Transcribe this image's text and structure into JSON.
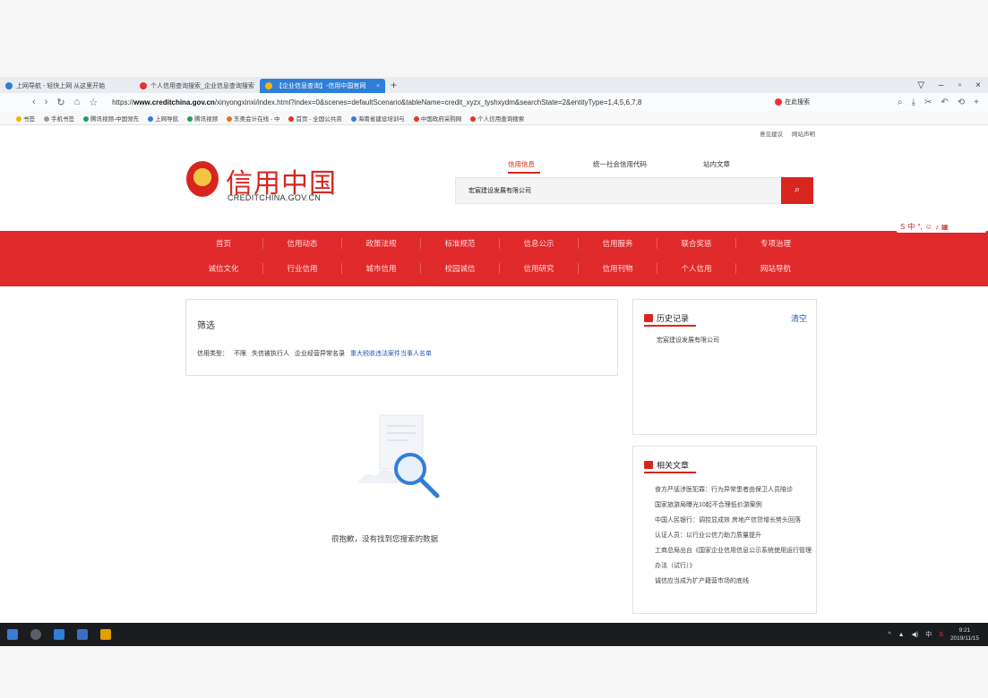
{
  "browser": {
    "tabs": [
      {
        "label": "上网导航 - 轻快上网 从这里开始",
        "active": false
      },
      {
        "label": "个人信用查询搜索_企业信息查询搜索",
        "active": false
      },
      {
        "label": "【企业信息查询】-信用中国官网",
        "active": true
      }
    ],
    "new_tab": "+",
    "url_prefix": "https://",
    "url_host": "www.creditchina.gov.cn",
    "url_path": "/xinyongxinxi/index.html?index=0&scenes=defaultScenario&tableName=credit_xyzx_tyshxydm&searchState=2&entityType=1,4,5,6,7,8",
    "search_engine_label": "在此搜索",
    "bookmarks": [
      "书签",
      "手机书签",
      "腾讯视频-中国领先",
      "上网导航",
      "腾讯视频",
      "东奥会计在线 - 中",
      "首页 - 全国公共资",
      "海南省建设培训与",
      "中国政府采购网",
      "个人信用查询搜索"
    ]
  },
  "page": {
    "top_links": [
      "意见建议",
      "网站声明"
    ],
    "logo": {
      "cn": "信用中国",
      "en": "CREDITCHINA.GOV.CN"
    },
    "search_tabs": [
      "信用信息",
      "统一社会信用代码",
      "站内文章"
    ],
    "search_value": "宏宸建设发展有限公司",
    "search_icon": "search-icon",
    "nav_row1": [
      "首页",
      "信用动态",
      "政策法规",
      "标准规范",
      "信息公示",
      "信用服务",
      "联合奖惩",
      "专项治理"
    ],
    "nav_row2": [
      "诚信文化",
      "行业信用",
      "城市信用",
      "校园诚信",
      "信用研究",
      "信用刊物",
      "个人信用",
      "网站导航"
    ],
    "filter": {
      "title": "筛选",
      "label": "信用类型：",
      "options": [
        "不限",
        "失信被执行人",
        "企业经营异常名录",
        "重大税收违法案件当事人名单"
      ],
      "active_index": 3
    },
    "empty_message": "很抱歉，没有找到您搜索的数据",
    "history": {
      "title": "历史记录",
      "clear_label": "清空",
      "items": [
        "宏宸建设发展有限公司"
      ]
    },
    "articles": {
      "title": "相关文章",
      "items": [
        "食方严惩涉医犯罪：行为异常患者由保卫人员陪诊",
        "国家旅游局曝光10起不合理低价游案例",
        "中国人民银行：调控显成效 房地产信贷增长势头回落",
        "认证人员：以行业公信力助力质量提升",
        "工商总局出台《国家企业信用信息公示系统使用运行管理办法（试行）》",
        "诚信应当成为扩产籍营市场的底线"
      ]
    }
  },
  "taskbar": {
    "time": "9:21",
    "date": "2019/11/15"
  },
  "colors": {
    "brand_red": "#d8261f",
    "nav_red": "#e0292b",
    "link_blue": "#2359b8",
    "tab_blue": "#2f7fd8"
  }
}
